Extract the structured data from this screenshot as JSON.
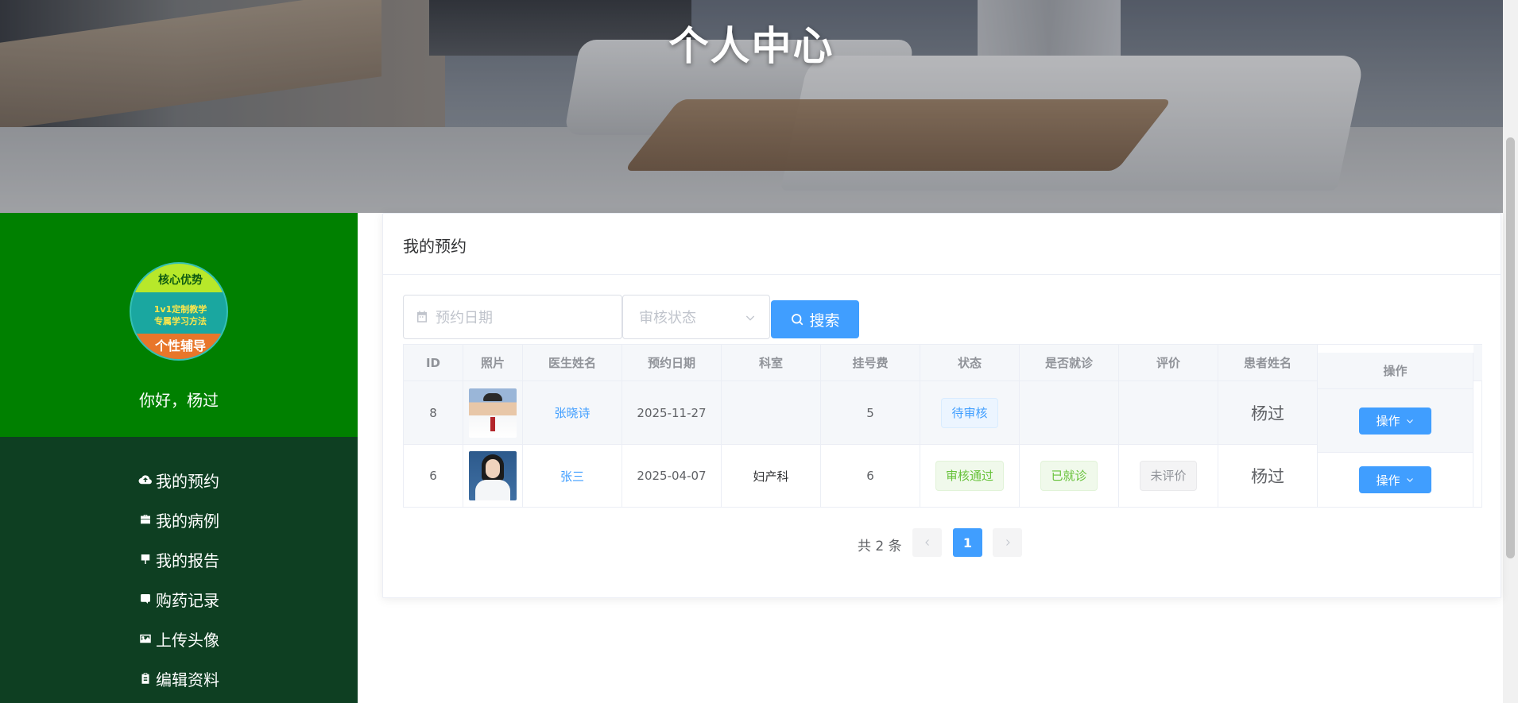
{
  "banner": {
    "title": "个人中心"
  },
  "sidebar": {
    "avatar": {
      "line1": "核心优势",
      "line2": "1v1定制教学",
      "line3": "专属学习方法",
      "line4": "个性辅导"
    },
    "greeting": "你好，杨过",
    "menu": [
      {
        "label": "我的预约",
        "icon": "cloud-upload-icon"
      },
      {
        "label": "我的病例",
        "icon": "briefcase-icon"
      },
      {
        "label": "我的报告",
        "icon": "report-icon"
      },
      {
        "label": "购药记录",
        "icon": "purchase-icon"
      },
      {
        "label": "上传头像",
        "icon": "image-icon"
      },
      {
        "label": "编辑资料",
        "icon": "clipboard-icon"
      }
    ]
  },
  "card": {
    "title": "我的预约",
    "filters": {
      "date_placeholder": "预约日期",
      "status_placeholder": "审核状态",
      "search_label": "搜索"
    },
    "table": {
      "headers": [
        "ID",
        "照片",
        "医生姓名",
        "预约日期",
        "科室",
        "挂号费",
        "状态",
        "是否就诊",
        "评价",
        "患者姓名",
        "操作"
      ],
      "rows": [
        {
          "id": "8",
          "doctor": "张晓诗",
          "date": "2025-11-27",
          "dept": "",
          "fee": "5",
          "status": "待审核",
          "visited": "",
          "review": "",
          "patient": "杨过",
          "action": "操作"
        },
        {
          "id": "6",
          "doctor": "张三",
          "date": "2025-04-07",
          "dept": "妇产科",
          "fee": "6",
          "status": "审核通过",
          "visited": "已就诊",
          "review": "未评价",
          "patient": "杨过",
          "action": "操作"
        }
      ]
    },
    "pagination": {
      "total": "共 2 条",
      "current_page": "1"
    }
  },
  "colors": {
    "primary": "#409eff",
    "sidebar_top": "#008000",
    "sidebar_menu": "#0e3f22",
    "success": "#67c23a"
  }
}
